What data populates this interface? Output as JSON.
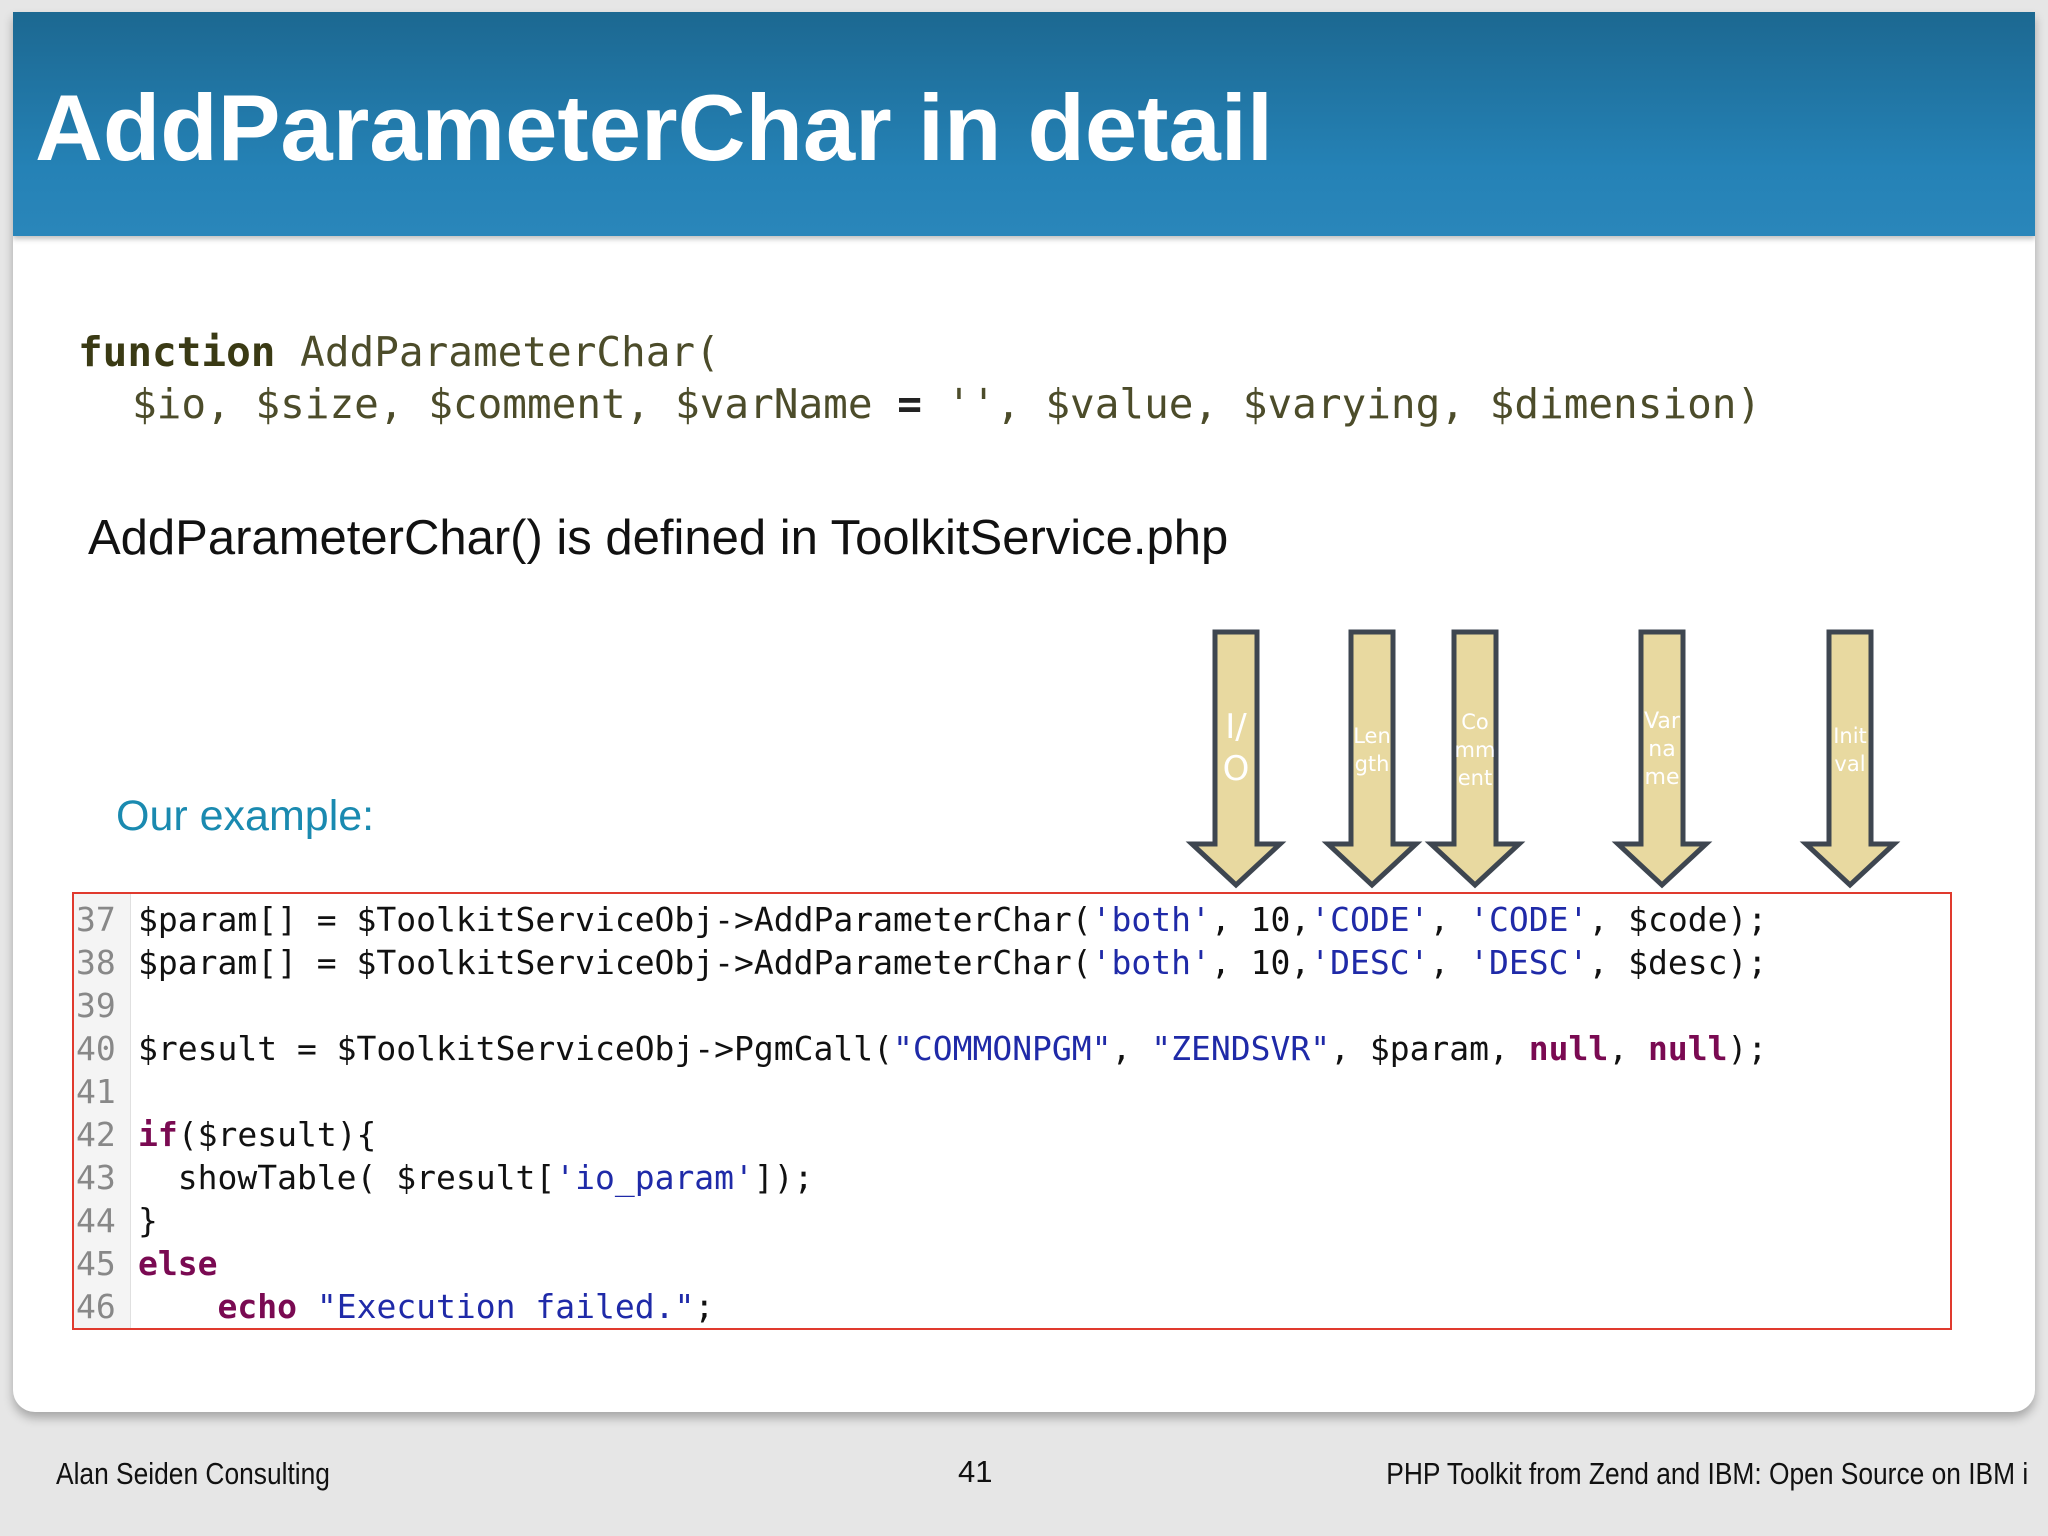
{
  "slide": {
    "title": "AddParameterChar in detail",
    "signature": {
      "keyword": "function",
      "name": " AddParameterChar(",
      "params_a": "$io, $size, $comment, $varName ",
      "equals": "=",
      "params_b": " '', $value, $varying, $dimension)"
    },
    "defined_text": "AddParameterChar() is defined in ToolkitService.php",
    "example_label": "Our example:"
  },
  "arrows": [
    {
      "label": "I/\nO"
    },
    {
      "label": "Len\ngth"
    },
    {
      "label": "Co\nmm\nent"
    },
    {
      "label": "Var\nna\nme"
    },
    {
      "label": "Init\nval"
    }
  ],
  "colors": {
    "title_bar": "#2582b6",
    "arrow_fill": "#e8d9a0",
    "arrow_stroke": "#3e4650",
    "code_border": "#e03a2e",
    "string": "#1f2aa8",
    "keyword": "#7a0a52",
    "example_label": "#1a8ab0"
  },
  "code": {
    "lines": [
      {
        "num": "37",
        "segments": [
          {
            "t": "$param[] = $ToolkitServiceObj->AddParameterChar(",
            "c": ""
          },
          {
            "t": "'both'",
            "c": "str"
          },
          {
            "t": ", 10,",
            "c": ""
          },
          {
            "t": "'CODE'",
            "c": "str"
          },
          {
            "t": ", ",
            "c": ""
          },
          {
            "t": "'CODE'",
            "c": "str"
          },
          {
            "t": ", $code);",
            "c": ""
          }
        ]
      },
      {
        "num": "38",
        "segments": [
          {
            "t": "$param[] = $ToolkitServiceObj->AddParameterChar(",
            "c": ""
          },
          {
            "t": "'both'",
            "c": "str"
          },
          {
            "t": ", 10,",
            "c": ""
          },
          {
            "t": "'DESC'",
            "c": "str"
          },
          {
            "t": ", ",
            "c": ""
          },
          {
            "t": "'DESC'",
            "c": "str"
          },
          {
            "t": ", $desc);",
            "c": ""
          }
        ]
      },
      {
        "num": "39",
        "segments": []
      },
      {
        "num": "40",
        "segments": [
          {
            "t": "$result = $ToolkitServiceObj->PgmCall(",
            "c": ""
          },
          {
            "t": "\"COMMONPGM\"",
            "c": "str"
          },
          {
            "t": ", ",
            "c": ""
          },
          {
            "t": "\"ZENDSVR\"",
            "c": "str"
          },
          {
            "t": ", $param, ",
            "c": ""
          },
          {
            "t": "null",
            "c": "kwd"
          },
          {
            "t": ", ",
            "c": ""
          },
          {
            "t": "null",
            "c": "kwd"
          },
          {
            "t": ");",
            "c": ""
          }
        ]
      },
      {
        "num": "41",
        "segments": []
      },
      {
        "num": "42",
        "segments": [
          {
            "t": "if",
            "c": "kwd"
          },
          {
            "t": "($result){",
            "c": ""
          }
        ]
      },
      {
        "num": "43",
        "segments": [
          {
            "t": "  showTable( $result[",
            "c": ""
          },
          {
            "t": "'io_param'",
            "c": "str"
          },
          {
            "t": "]);",
            "c": ""
          }
        ]
      },
      {
        "num": "44",
        "segments": [
          {
            "t": "}",
            "c": ""
          }
        ]
      },
      {
        "num": "45",
        "segments": [
          {
            "t": "else",
            "c": "kwd"
          }
        ]
      },
      {
        "num": "46",
        "segments": [
          {
            "t": "    ",
            "c": ""
          },
          {
            "t": "echo",
            "c": "kwd"
          },
          {
            "t": " ",
            "c": ""
          },
          {
            "t": "\"Execution failed.\"",
            "c": "str"
          },
          {
            "t": ";",
            "c": ""
          }
        ]
      }
    ]
  },
  "footer": {
    "left": "Alan Seiden Consulting",
    "page": "41",
    "right": "PHP Toolkit from Zend and IBM: Open Source on IBM i"
  }
}
